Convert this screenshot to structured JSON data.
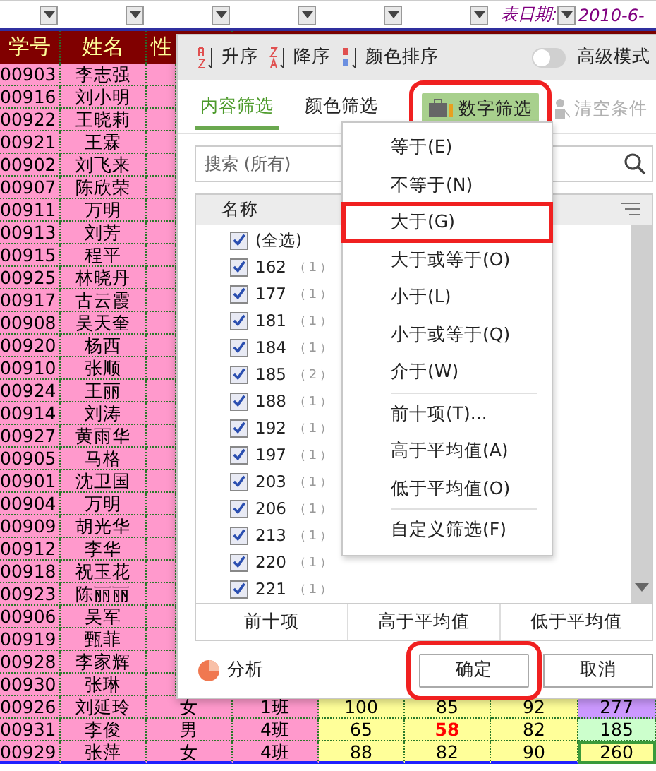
{
  "sheet": {
    "date_label": "表日期:",
    "date_value": "2010-6-",
    "columns": [
      "学号",
      "姓名",
      "性"
    ],
    "rows": [
      {
        "id": "00903",
        "name": "李志强"
      },
      {
        "id": "00916",
        "name": "刘小明"
      },
      {
        "id": "00922",
        "name": "王晓莉"
      },
      {
        "id": "00921",
        "name": "王霖"
      },
      {
        "id": "00902",
        "name": "刘飞来"
      },
      {
        "id": "00907",
        "name": "陈欣荣"
      },
      {
        "id": "00911",
        "name": "万明"
      },
      {
        "id": "00913",
        "name": "刘芳"
      },
      {
        "id": "00915",
        "name": "程平"
      },
      {
        "id": "00925",
        "name": "林晓丹"
      },
      {
        "id": "00917",
        "name": "古云霞"
      },
      {
        "id": "00908",
        "name": "吴天奎"
      },
      {
        "id": "00920",
        "name": "杨西"
      },
      {
        "id": "00910",
        "name": "张顺"
      },
      {
        "id": "00924",
        "name": "王丽"
      },
      {
        "id": "00914",
        "name": "刘涛"
      },
      {
        "id": "00927",
        "name": "黄雨华"
      },
      {
        "id": "00905",
        "name": "马格"
      },
      {
        "id": "00901",
        "name": "沈卫国"
      },
      {
        "id": "00904",
        "name": "万明"
      },
      {
        "id": "00909",
        "name": "胡光华"
      },
      {
        "id": "00912",
        "name": "李华"
      },
      {
        "id": "00918",
        "name": "祝玉花"
      },
      {
        "id": "00923",
        "name": "陈丽丽"
      },
      {
        "id": "00906",
        "name": "吴军"
      },
      {
        "id": "00919",
        "name": "甄菲"
      },
      {
        "id": "00928",
        "name": "李家辉"
      },
      {
        "id": "00930",
        "name": "张琳"
      },
      {
        "id": "00926",
        "name": "刘延玲",
        "gender": "女",
        "class": "1班",
        "scores": [
          {
            "text": "100",
            "low": false
          },
          {
            "text": "85",
            "low": false
          },
          {
            "text": "92",
            "low": false
          }
        ],
        "total": {
          "text": "277",
          "color": "#cc99ff",
          "selected": false
        }
      },
      {
        "id": "00931",
        "name": "李俊",
        "gender": "男",
        "class": "4班",
        "scores": [
          {
            "text": "65",
            "low": false
          },
          {
            "text": "58",
            "low": true
          },
          {
            "text": "82",
            "low": false
          }
        ],
        "total": {
          "text": "185",
          "color": "#ccffcc",
          "selected": false
        }
      },
      {
        "id": "00929",
        "name": "张萍",
        "gender": "女",
        "class": "4班",
        "scores": [
          {
            "text": "88",
            "low": false
          },
          {
            "text": "82",
            "low": false
          },
          {
            "text": "90",
            "low": false
          }
        ],
        "total": {
          "text": "260",
          "color": "#ffff99",
          "selected": true
        }
      }
    ]
  },
  "filter_dialog": {
    "sort_buttons": [
      {
        "kind": "asc",
        "label": "升序"
      },
      {
        "kind": "desc",
        "label": "降序"
      },
      {
        "kind": "color",
        "label": "颜色排序"
      }
    ],
    "advanced_mode": {
      "label": "高级模式",
      "on": false
    },
    "tabs": [
      {
        "label": "内容筛选",
        "selected": true
      },
      {
        "label": "颜色筛选",
        "selected": false
      }
    ],
    "number_filter": {
      "label": "数字筛选",
      "highlighted": true
    },
    "clear": {
      "label": "清空条件",
      "disabled": true
    },
    "search": {
      "placeholder": "搜索 (所有)"
    },
    "list": {
      "header": "名称",
      "items": [
        {
          "label": "(全选)",
          "checked": true
        },
        {
          "label": "162",
          "count": "（ 1 ）",
          "checked": true
        },
        {
          "label": "177",
          "count": "（ 1 ）",
          "checked": true
        },
        {
          "label": "181",
          "count": "（ 1 ）",
          "checked": true
        },
        {
          "label": "184",
          "count": "（ 1 ）",
          "checked": true
        },
        {
          "label": "185",
          "count": "（ 2 ）",
          "checked": true
        },
        {
          "label": "188",
          "count": "（ 1 ）",
          "checked": true
        },
        {
          "label": "192",
          "count": "（ 1 ）",
          "checked": true
        },
        {
          "label": "197",
          "count": "（ 1 ）",
          "checked": true
        },
        {
          "label": "203",
          "count": "（ 1 ）",
          "checked": true
        },
        {
          "label": "206",
          "count": "（ 1 ）",
          "checked": true
        },
        {
          "label": "213",
          "count": "（ 1 ）",
          "checked": true
        },
        {
          "label": "220",
          "count": "（ 1 ）",
          "checked": true
        },
        {
          "label": "221",
          "count": "（ 1 ）",
          "checked": true
        }
      ]
    },
    "quick_buttons": [
      "前十项",
      "高于平均值",
      "低于平均值"
    ],
    "analyze": "分析",
    "ok": {
      "label": "确定",
      "highlighted": true
    },
    "cancel": "取消"
  },
  "menu": {
    "items": [
      {
        "kind": "item",
        "label": "等于(E)",
        "highlighted": false
      },
      {
        "kind": "item",
        "label": "不等于(N)",
        "highlighted": false
      },
      {
        "kind": "item",
        "label": "大于(G)",
        "highlighted": true
      },
      {
        "kind": "item",
        "label": "大于或等于(O)",
        "highlighted": false
      },
      {
        "kind": "item",
        "label": "小于(L)",
        "highlighted": false
      },
      {
        "kind": "item",
        "label": "小于或等于(Q)",
        "highlighted": false
      },
      {
        "kind": "item",
        "label": "介于(W)",
        "highlighted": false
      },
      {
        "kind": "separator"
      },
      {
        "kind": "item",
        "label": "前十项(T)...",
        "highlighted": false
      },
      {
        "kind": "item",
        "label": "高于平均值(A)",
        "highlighted": false
      },
      {
        "kind": "item",
        "label": "低于平均值(O)",
        "highlighted": false
      },
      {
        "kind": "separator"
      },
      {
        "kind": "item",
        "label": "自定义筛选(F)",
        "highlighted": false
      }
    ]
  }
}
